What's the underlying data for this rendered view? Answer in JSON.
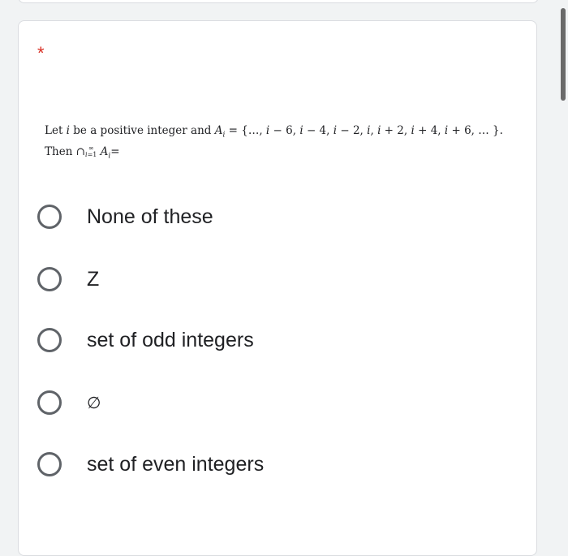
{
  "question": {
    "required_marker": "*",
    "line1": "Let i be a positive integer and A_i = {..., i − 6, i − 4, i − 2, i, i + 2, i + 4, i + 6, ... }.",
    "line2": "Then ∩_{i=1}^{∞} A_i ="
  },
  "options": [
    {
      "label": "None of these",
      "selected": false
    },
    {
      "label": "Z",
      "selected": false
    },
    {
      "label": "set of odd integers",
      "selected": false
    },
    {
      "label": "∅",
      "selected": false
    },
    {
      "label": "set of even integers",
      "selected": false
    }
  ],
  "colors": {
    "page_background": "#f1f3f4",
    "card_background": "#ffffff",
    "required": "#d93025",
    "radio_border": "#5f6368"
  }
}
